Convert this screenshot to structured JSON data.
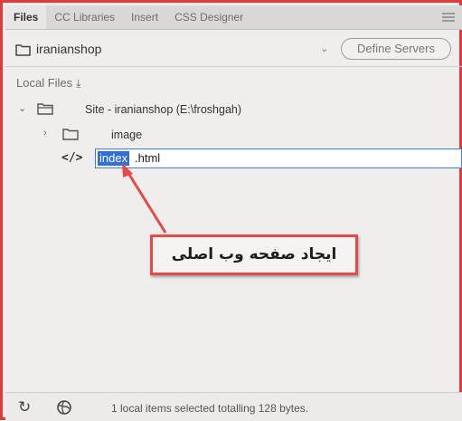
{
  "tabs": [
    "Files",
    "CC Libraries",
    "Insert",
    "CSS Designer"
  ],
  "site_bar": {
    "site_name": "iranianshop",
    "dropdown_icon": "chevron-down",
    "define_servers_label": "Define Servers"
  },
  "local_files_label": "Local Files",
  "tree": {
    "root_label": "Site - iranianshop (E:\\froshgah)",
    "folder_label": "image",
    "file_selected_part": "index",
    "file_rest_part": ".html"
  },
  "callout_text": "ایجاد صفحه وب اصلی",
  "status": {
    "text": "1 local items selected totalling 128 bytes."
  },
  "colors": {
    "highlight_border": "#e23a3a",
    "selection_blue": "#2f6fd6"
  }
}
